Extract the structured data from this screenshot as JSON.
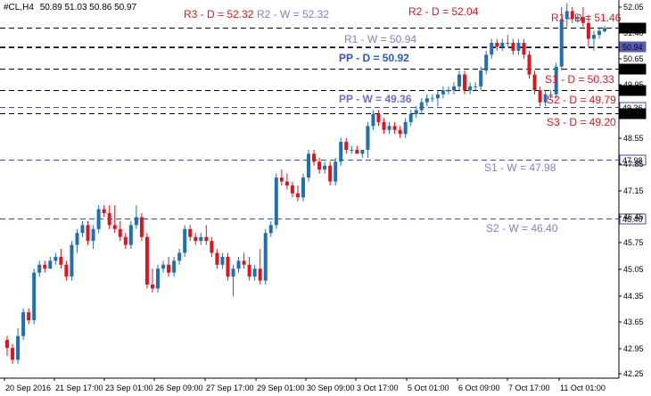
{
  "header": {
    "symbol": "#CL,H4",
    "ohlc": "50.89 51.03 50.86 50.97"
  },
  "chart_data": {
    "type": "candlestick",
    "ylim": [
      42.25,
      51.5
    ],
    "y_ticks": [
      "52.05",
      "51.40",
      "50.65",
      "49.95",
      "49.25",
      "48.55",
      "47.85",
      "47.15",
      "46.45",
      "45.75",
      "45.05",
      "44.35",
      "43.65",
      "42.95",
      "42.25"
    ],
    "x_ticks": [
      "20 Sep 2016",
      "21 Sep 17:00",
      "23 Sep 01:00",
      "26 Sep 09:00",
      "27 Sep 17:00",
      "29 Sep 01:00",
      "30 Sep 09:00",
      "3 Oct 17:00",
      "5 Oct 01:00",
      "6 Oct 09:00",
      "7 Oct 17:00",
      "11 Oct 01:00"
    ],
    "colors": {
      "bull": "#1f6fb5",
      "bear": "#e0141e",
      "daily_line": "#000000",
      "weekly_line": "#4a4aaa",
      "daily_label": "#e0141e",
      "weekly_label": "#8080cc",
      "price_tag_bg": "#5a5ab4"
    },
    "levels": [
      {
        "value": 52.32,
        "label": "R3 - D = 52.32",
        "kind": "daily"
      },
      {
        "value": 52.32,
        "label": "R2 - W = 52.32",
        "kind": "weekly"
      },
      {
        "value": 52.04,
        "label": "R2 - D = 52.04",
        "kind": "daily"
      },
      {
        "value": 51.46,
        "label": "R1 - D = 51.46",
        "kind": "daily",
        "tag": "51.46"
      },
      {
        "value": 50.94,
        "label": "R1 - W = 50.94",
        "kind": "weekly",
        "tag": "50.94",
        "tag_style": "highlight"
      },
      {
        "value": 50.92,
        "label": "PP - D = 50.92",
        "kind": "pivot_daily"
      },
      {
        "value": 50.33,
        "label": "S1 - D = 50.33",
        "kind": "daily",
        "tag": "50.33"
      },
      {
        "value": 49.79,
        "label": "S2 - D = 49.79",
        "kind": "daily",
        "tag": "49.79"
      },
      {
        "value": 49.36,
        "label": "PP - W = 49.36",
        "kind": "pivot_weekly",
        "tag": "49.36",
        "tag_style": "weekly"
      },
      {
        "value": 49.2,
        "label": "S3 - D = 49.20",
        "kind": "daily",
        "tag": "49.20"
      },
      {
        "value": 47.98,
        "label": "S1 - W = 47.98",
        "kind": "weekly",
        "tag": "47.98",
        "tag_style": "weekly"
      },
      {
        "value": 46.4,
        "label": "S2 - W = 46.40",
        "kind": "weekly",
        "tag": "46.40",
        "tag_style": "weekly"
      }
    ],
    "candles": [
      [
        43.1,
        43.2,
        42.7,
        42.9
      ],
      [
        42.9,
        43.0,
        42.5,
        42.6
      ],
      [
        42.6,
        43.4,
        42.5,
        43.2
      ],
      [
        43.2,
        43.9,
        43.1,
        43.8
      ],
      [
        43.8,
        43.9,
        43.5,
        43.6
      ],
      [
        43.6,
        44.9,
        43.5,
        44.8
      ],
      [
        44.8,
        45.1,
        44.7,
        45.0
      ],
      [
        45.0,
        45.1,
        44.8,
        44.9
      ],
      [
        44.9,
        45.2,
        44.9,
        45.1
      ],
      [
        45.1,
        45.3,
        45.0,
        45.2
      ],
      [
        45.2,
        45.4,
        44.9,
        45.0
      ],
      [
        45.0,
        45.1,
        44.6,
        44.7
      ],
      [
        44.7,
        45.6,
        44.6,
        45.5
      ],
      [
        45.5,
        45.9,
        45.3,
        45.8
      ],
      [
        45.8,
        46.1,
        45.7,
        46.0
      ],
      [
        46.0,
        46.1,
        45.5,
        45.6
      ],
      [
        45.6,
        46.0,
        45.4,
        45.9
      ],
      [
        45.9,
        46.5,
        45.8,
        46.4
      ],
      [
        46.4,
        46.5,
        46.2,
        46.3
      ],
      [
        46.3,
        46.5,
        45.9,
        46.0
      ],
      [
        46.0,
        46.5,
        45.8,
        45.9
      ],
      [
        45.9,
        46.1,
        45.6,
        45.7
      ],
      [
        45.7,
        45.8,
        45.4,
        45.5
      ],
      [
        45.5,
        46.1,
        45.4,
        46.0
      ],
      [
        46.0,
        46.5,
        45.9,
        46.2
      ],
      [
        46.2,
        46.3,
        45.6,
        45.7
      ],
      [
        45.7,
        45.8,
        44.4,
        44.5
      ],
      [
        44.5,
        44.9,
        44.3,
        44.4
      ],
      [
        44.4,
        45.0,
        44.3,
        44.9
      ],
      [
        44.9,
        45.1,
        44.8,
        45.0
      ],
      [
        45.0,
        45.2,
        44.7,
        44.8
      ],
      [
        44.8,
        45.2,
        44.7,
        45.1
      ],
      [
        45.1,
        45.4,
        45.0,
        45.3
      ],
      [
        45.3,
        46.0,
        45.2,
        45.9
      ],
      [
        45.9,
        46.0,
        45.6,
        45.7
      ],
      [
        45.7,
        45.8,
        45.5,
        45.6
      ],
      [
        45.6,
        45.8,
        45.5,
        45.7
      ],
      [
        45.7,
        46.0,
        45.5,
        45.6
      ],
      [
        45.6,
        45.7,
        45.2,
        45.3
      ],
      [
        45.3,
        45.4,
        44.9,
        45.0
      ],
      [
        45.0,
        45.3,
        44.9,
        45.2
      ],
      [
        45.2,
        45.3,
        44.6,
        44.7
      ],
      [
        44.7,
        45.0,
        44.2,
        44.9
      ],
      [
        44.9,
        45.2,
        44.8,
        45.1
      ],
      [
        45.1,
        45.3,
        44.9,
        45.0
      ],
      [
        45.0,
        45.2,
        44.6,
        44.7
      ],
      [
        44.7,
        45.0,
        44.6,
        44.9
      ],
      [
        44.9,
        45.4,
        44.5,
        44.6
      ],
      [
        44.6,
        45.9,
        44.5,
        45.8
      ],
      [
        45.8,
        46.1,
        45.7,
        46.0
      ],
      [
        46.0,
        47.3,
        45.9,
        47.2
      ],
      [
        47.2,
        47.4,
        47.0,
        47.1
      ],
      [
        47.1,
        47.3,
        46.9,
        47.0
      ],
      [
        47.0,
        47.1,
        46.7,
        46.8
      ],
      [
        46.8,
        47.0,
        46.6,
        46.7
      ],
      [
        46.7,
        47.3,
        46.6,
        47.2
      ],
      [
        47.2,
        47.9,
        47.1,
        47.8
      ],
      [
        47.8,
        47.9,
        47.5,
        47.6
      ],
      [
        47.6,
        47.7,
        47.3,
        47.4
      ],
      [
        47.4,
        47.6,
        47.3,
        47.5
      ],
      [
        47.5,
        47.6,
        47.0,
        47.1
      ],
      [
        47.1,
        47.7,
        47.0,
        47.6
      ],
      [
        47.6,
        48.2,
        47.5,
        48.1
      ],
      [
        48.1,
        48.2,
        47.8,
        47.9
      ],
      [
        47.9,
        48.0,
        47.8,
        47.9
      ],
      [
        47.9,
        48.0,
        47.8,
        47.8
      ],
      [
        47.8,
        47.9,
        47.7,
        47.9
      ],
      [
        47.9,
        48.6,
        47.7,
        48.5
      ],
      [
        48.5,
        48.9,
        48.4,
        48.8
      ],
      [
        48.8,
        48.9,
        48.5,
        48.6
      ],
      [
        48.6,
        48.7,
        48.3,
        48.4
      ],
      [
        48.4,
        48.6,
        48.3,
        48.5
      ],
      [
        48.5,
        48.6,
        48.3,
        48.4
      ],
      [
        48.4,
        48.5,
        48.2,
        48.3
      ],
      [
        48.3,
        48.7,
        48.2,
        48.6
      ],
      [
        48.6,
        48.9,
        48.5,
        48.8
      ],
      [
        48.8,
        49.0,
        48.7,
        48.9
      ],
      [
        48.9,
        49.2,
        48.8,
        49.1
      ],
      [
        49.1,
        49.3,
        49.0,
        49.2
      ],
      [
        49.2,
        49.3,
        49.1,
        49.2
      ],
      [
        49.2,
        49.4,
        49.0,
        49.3
      ],
      [
        49.3,
        49.5,
        49.2,
        49.4
      ],
      [
        49.4,
        49.5,
        49.3,
        49.4
      ],
      [
        49.4,
        49.6,
        49.3,
        49.5
      ],
      [
        49.5,
        49.9,
        49.4,
        49.8
      ],
      [
        49.8,
        49.9,
        49.3,
        49.4
      ],
      [
        49.4,
        49.6,
        49.3,
        49.5
      ],
      [
        49.5,
        49.6,
        49.4,
        49.5
      ],
      [
        49.5,
        50.0,
        49.4,
        49.9
      ],
      [
        49.9,
        50.4,
        49.8,
        50.3
      ],
      [
        50.3,
        50.7,
        50.2,
        50.6
      ],
      [
        50.6,
        50.7,
        50.4,
        50.5
      ],
      [
        50.5,
        50.7,
        50.4,
        50.6
      ],
      [
        50.6,
        50.8,
        50.5,
        50.6
      ],
      [
        50.6,
        50.7,
        50.3,
        50.4
      ],
      [
        50.4,
        50.7,
        50.3,
        50.6
      ],
      [
        50.6,
        50.7,
        50.2,
        50.3
      ],
      [
        50.3,
        50.4,
        49.7,
        49.8
      ],
      [
        49.8,
        49.9,
        49.3,
        49.4
      ],
      [
        49.4,
        49.5,
        49.0,
        49.1
      ],
      [
        49.1,
        49.4,
        49.0,
        49.3
      ],
      [
        49.3,
        49.4,
        49.2,
        49.3
      ],
      [
        49.3,
        50.1,
        49.2,
        50.0
      ],
      [
        50.0,
        51.5,
        49.9,
        51.2
      ],
      [
        51.2,
        51.6,
        51.0,
        51.4
      ],
      [
        51.4,
        51.5,
        51.1,
        51.2
      ],
      [
        51.2,
        51.3,
        51.1,
        51.25
      ],
      [
        51.25,
        51.5,
        51.0,
        51.1
      ],
      [
        51.1,
        51.3,
        50.5,
        50.7
      ],
      [
        50.7,
        50.9,
        50.4,
        50.8
      ],
      [
        50.8,
        51.0,
        50.7,
        50.9
      ],
      [
        50.89,
        51.03,
        50.86,
        50.97
      ]
    ]
  }
}
